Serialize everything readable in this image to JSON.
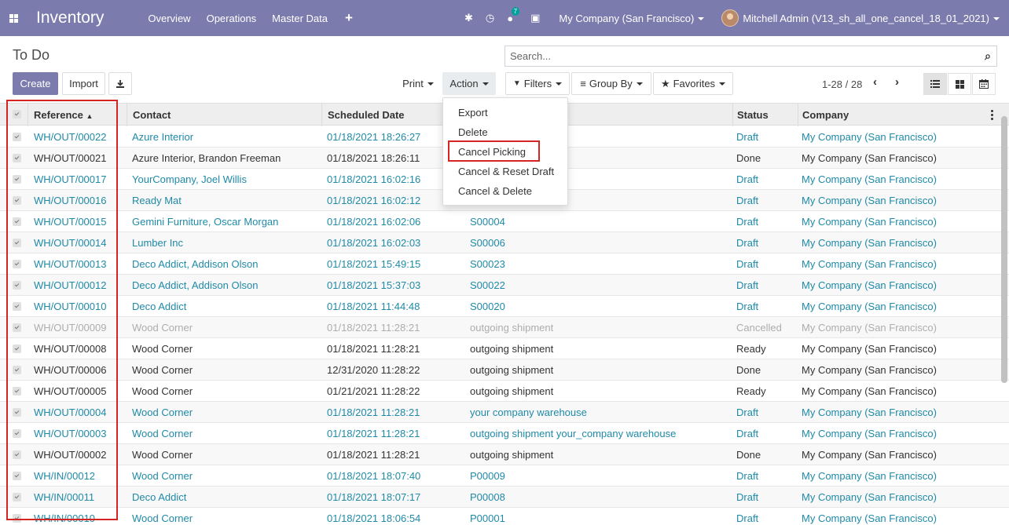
{
  "navbar": {
    "app_title": "Inventory",
    "menu": [
      "Overview",
      "Operations",
      "Master Data"
    ],
    "notification_count": "7",
    "company": "My Company (San Francisco)",
    "user": "Mitchell Admin (V13_sh_all_one_cancel_18_01_2021)"
  },
  "control_panel": {
    "title": "To Do",
    "create_label": "Create",
    "import_label": "Import",
    "print_label": "Print",
    "action_label": "Action",
    "filters_label": "Filters",
    "group_by_label": "Group By",
    "favorites_label": "Favorites",
    "search_placeholder": "Search...",
    "pager": "1-28 / 28"
  },
  "action_menu": {
    "items": [
      "Export",
      "Delete",
      "Cancel Picking",
      "Cancel & Reset Draft",
      "Cancel & Delete"
    ]
  },
  "table": {
    "headers": [
      "Reference",
      "Contact",
      "Scheduled Date",
      "Status",
      "Company"
    ],
    "rows": [
      {
        "ref": "WH/OUT/00022",
        "contact": "Azure Interior",
        "date": "01/18/2021 18:26:27",
        "source": "",
        "status": "Draft",
        "company": "My Company (San Francisco)",
        "style": "blue"
      },
      {
        "ref": "WH/OUT/00021",
        "contact": "Azure Interior, Brandon Freeman",
        "date": "01/18/2021 18:26:11",
        "source": "",
        "status": "Done",
        "company": "My Company (San Francisco)",
        "style": "normal"
      },
      {
        "ref": "WH/OUT/00017",
        "contact": "YourCompany, Joel Willis",
        "date": "01/18/2021 16:02:16",
        "source": "",
        "status": "Draft",
        "company": "My Company (San Francisco)",
        "style": "blue"
      },
      {
        "ref": "WH/OUT/00016",
        "contact": "Ready Mat",
        "date": "01/18/2021 16:02:12",
        "source": "",
        "status": "Draft",
        "company": "My Company (San Francisco)",
        "style": "blue"
      },
      {
        "ref": "WH/OUT/00015",
        "contact": "Gemini Furniture, Oscar Morgan",
        "date": "01/18/2021 16:02:06",
        "source": "S00004",
        "status": "Draft",
        "company": "My Company (San Francisco)",
        "style": "blue"
      },
      {
        "ref": "WH/OUT/00014",
        "contact": "Lumber Inc",
        "date": "01/18/2021 16:02:03",
        "source": "S00006",
        "status": "Draft",
        "company": "My Company (San Francisco)",
        "style": "blue"
      },
      {
        "ref": "WH/OUT/00013",
        "contact": "Deco Addict, Addison Olson",
        "date": "01/18/2021 15:49:15",
        "source": "S00023",
        "status": "Draft",
        "company": "My Company (San Francisco)",
        "style": "blue"
      },
      {
        "ref": "WH/OUT/00012",
        "contact": "Deco Addict, Addison Olson",
        "date": "01/18/2021 15:37:03",
        "source": "S00022",
        "status": "Draft",
        "company": "My Company (San Francisco)",
        "style": "blue"
      },
      {
        "ref": "WH/OUT/00010",
        "contact": "Deco Addict",
        "date": "01/18/2021 11:44:48",
        "source": "S00020",
        "status": "Draft",
        "company": "My Company (San Francisco)",
        "style": "blue"
      },
      {
        "ref": "WH/OUT/00009",
        "contact": "Wood Corner",
        "date": "01/18/2021 11:28:21",
        "source": "outgoing shipment",
        "status": "Cancelled",
        "company": "My Company (San Francisco)",
        "style": "muted"
      },
      {
        "ref": "WH/OUT/00008",
        "contact": "Wood Corner",
        "date": "01/18/2021 11:28:21",
        "source": "outgoing shipment",
        "status": "Ready",
        "company": "My Company (San Francisco)",
        "style": "normal"
      },
      {
        "ref": "WH/OUT/00006",
        "contact": "Wood Corner",
        "date": "12/31/2020 11:28:22",
        "source": "outgoing shipment",
        "status": "Done",
        "company": "My Company (San Francisco)",
        "style": "normal"
      },
      {
        "ref": "WH/OUT/00005",
        "contact": "Wood Corner",
        "date": "01/21/2021 11:28:22",
        "source": "outgoing shipment",
        "status": "Ready",
        "company": "My Company (San Francisco)",
        "style": "normal"
      },
      {
        "ref": "WH/OUT/00004",
        "contact": "Wood Corner",
        "date": "01/18/2021 11:28:21",
        "source": "your company warehouse",
        "status": "Draft",
        "company": "My Company (San Francisco)",
        "style": "blue"
      },
      {
        "ref": "WH/OUT/00003",
        "contact": "Wood Corner",
        "date": "01/18/2021 11:28:21",
        "source": "outgoing shipment your_company warehouse",
        "status": "Draft",
        "company": "My Company (San Francisco)",
        "style": "blue"
      },
      {
        "ref": "WH/OUT/00002",
        "contact": "Wood Corner",
        "date": "01/18/2021 11:28:21",
        "source": "outgoing shipment",
        "status": "Done",
        "company": "My Company (San Francisco)",
        "style": "normal"
      },
      {
        "ref": "WH/IN/00012",
        "contact": "Wood Corner",
        "date": "01/18/2021 18:07:40",
        "source": "P00009",
        "status": "Draft",
        "company": "My Company (San Francisco)",
        "style": "blue"
      },
      {
        "ref": "WH/IN/00011",
        "contact": "Deco Addict",
        "date": "01/18/2021 18:07:17",
        "source": "P00008",
        "status": "Draft",
        "company": "My Company (San Francisco)",
        "style": "blue"
      },
      {
        "ref": "WH/IN/00010",
        "contact": "Wood Corner",
        "date": "01/18/2021 18:06:54",
        "source": "P00001",
        "status": "Draft",
        "company": "My Company (San Francisco)",
        "style": "blue"
      }
    ]
  },
  "colors": {
    "navbar": "#7c7bad",
    "link": "#1f8aa8",
    "highlight": "#d42424"
  }
}
